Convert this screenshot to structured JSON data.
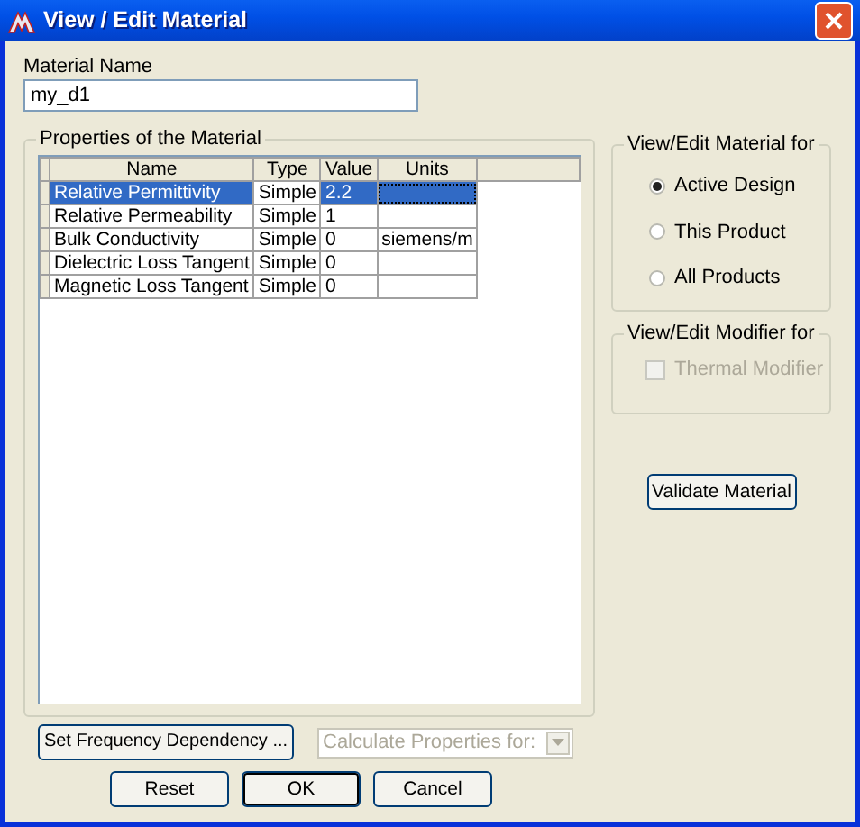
{
  "window": {
    "title": "View / Edit Material"
  },
  "material_name": {
    "label": "Material Name",
    "value": "my_d1"
  },
  "properties": {
    "title": "Properties of the Material",
    "columns": [
      "Name",
      "Type",
      "Value",
      "Units"
    ],
    "rows": [
      {
        "name": "Relative Permittivity",
        "type": "Simple",
        "value": "2.2",
        "selected": true
      },
      {
        "name": "Relative Permeability",
        "type": "Simple",
        "value": "1",
        "selected": false
      },
      {
        "name": "Bulk Conductivity",
        "type": "Simple",
        "value": "0",
        "units": "siemens/m",
        "selected": false
      },
      {
        "name": "Dielectric Loss Tangent",
        "type": "Simple",
        "value": "0",
        "selected": false
      },
      {
        "name": "Magnetic Loss Tangent",
        "type": "Simple",
        "value": "0",
        "selected": false
      }
    ]
  },
  "material_for": {
    "title": "View/Edit Material for",
    "options": [
      {
        "label": "Active Design",
        "selected": true
      },
      {
        "label": "This Product",
        "selected": false
      },
      {
        "label": "All Products",
        "selected": false
      }
    ]
  },
  "modifier_for": {
    "title": "View/Edit Modifier for",
    "options": [
      {
        "label": "Thermal Modifier",
        "checked": false,
        "disabled": true
      }
    ]
  },
  "validate_button": {
    "label": "Validate Material"
  },
  "frequency_button": {
    "label": "Set Frequency Dependency ..."
  },
  "calculate_dropdown": {
    "placeholder": "Calculate Properties for:",
    "disabled": true
  },
  "buttons": [
    {
      "label": "Reset",
      "default": false
    },
    {
      "label": "OK",
      "default": true
    },
    {
      "label": "Cancel",
      "default": false
    }
  ]
}
